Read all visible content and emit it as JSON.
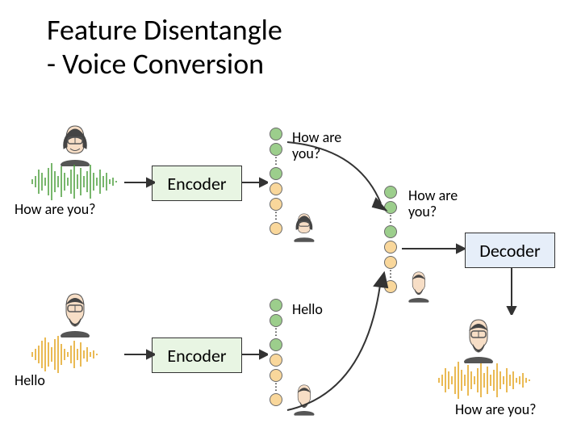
{
  "title_line1": "Feature Disentangle",
  "title_line2": "- Voice Conversion",
  "encoder_label": "Encoder",
  "decoder_label": "Decoder",
  "text_how": "How are you?",
  "text_hello": "Hello",
  "colors": {
    "content_feat": "#9cce8c",
    "speaker_feat": "#f9d79b",
    "encoder_fill": "#e8f5e3",
    "decoder_fill": "#e6eef9",
    "wave_green": "#4a9d3a",
    "wave_orange": "#e3a21a"
  }
}
